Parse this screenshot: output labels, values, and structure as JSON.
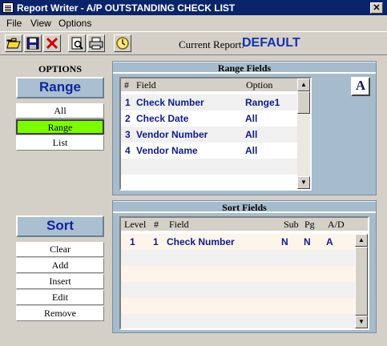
{
  "window": {
    "title": "Report Writer - A/P OUTSTANDING CHECK LIST",
    "close_label": "✕"
  },
  "menu": [
    {
      "label": "File"
    },
    {
      "label": "View"
    },
    {
      "label": "Options"
    }
  ],
  "toolbar": {
    "current_report_label": "Current Report:",
    "current_report_value": "DEFAULT"
  },
  "options": {
    "title": "OPTIONS",
    "range_heading": "Range",
    "range_buttons": [
      "All",
      "Range",
      "List"
    ],
    "selected_range_option": "Range",
    "sort_heading": "Sort",
    "sort_buttons": [
      "Clear",
      "Add",
      "Insert",
      "Edit",
      "Remove"
    ]
  },
  "range_fields": {
    "title": "Range  Fields",
    "columns": [
      "#",
      "Field",
      "Option"
    ],
    "rows": [
      {
        "num": "1",
        "field": "Check Number",
        "option": "Range1"
      },
      {
        "num": "2",
        "field": "Check Date",
        "option": "All"
      },
      {
        "num": "3",
        "field": "Vendor Number",
        "option": "All"
      },
      {
        "num": "4",
        "field": "Vendor Name",
        "option": "All"
      }
    ]
  },
  "sort_fields": {
    "title": "Sort Fields",
    "columns": [
      "Level",
      "#",
      "Field",
      "Sub",
      "Pg",
      "A/D"
    ],
    "rows": [
      {
        "level": "1",
        "num": "1",
        "field": "Check Number",
        "sub": "N",
        "pg": "N",
        "ad": "A"
      }
    ]
  },
  "font_button_glyph": "A",
  "icons": [
    "app-icon",
    "open-folder-icon",
    "save-icon",
    "delete-icon",
    "print-preview-icon",
    "print-icon",
    "clock-icon",
    "font-size-icon"
  ]
}
